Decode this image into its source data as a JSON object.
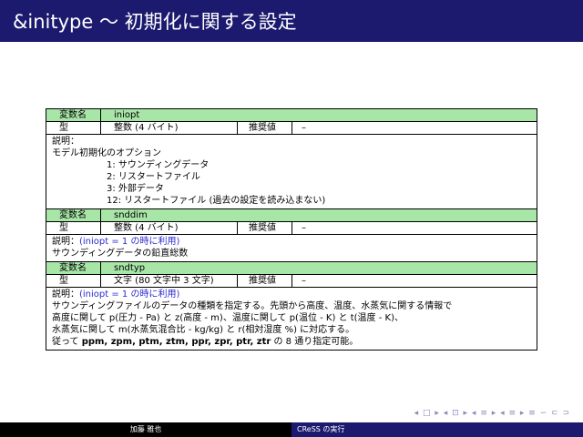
{
  "title": "&initype 〜 初期化に関する設定",
  "headers": {
    "var_label": "変数名",
    "type_label": "型",
    "rec_label": "推奨値",
    "desc_label": "説明："
  },
  "vars": [
    {
      "name": "iniopt",
      "type": "整数 (4 バイト)",
      "rec": "–",
      "desc_line": "モデル初期化のオプション",
      "options": [
        "1: サウンディングデータ",
        "2: リスタートファイル",
        "3: 外部データ",
        "12: リスタートファイル (過去の設定を読み込まない)"
      ]
    },
    {
      "name": "snddim",
      "type": "整数 (4 バイト)",
      "rec": "–",
      "cond": "(iniopt = 1 の時に利用)",
      "desc_line": "サウンディングデータの鉛直総数"
    },
    {
      "name": "sndtyp",
      "type": "文字 (80 文字中 3 文字)",
      "rec": "–",
      "cond": "(iniopt = 1 の時に利用)",
      "lines": [
        "サウンディングファイルのデータの種類を指定する。先頭から高度、温度、水蒸気に関する情報で",
        "高度に関して p(圧力 - Pa) と z(高度 - m)、温度に関して p(温位 - K) と t(温度 - K)、",
        "水蒸気に関して m(水蒸気混合比 - kg/kg) と r(相対湿度 %) に対応する。"
      ],
      "last_pre": "従って ",
      "last_bold": "ppm, zpm, ptm, ztm, ppr, zpr, ptr, ztr",
      "last_post": " の 8 通り指定可能。"
    }
  ],
  "nav_symbols": "◂ □ ▸ ◂ ⊡ ▸ ◂ ≡ ▸ ◂ ≡ ▸ ≡ ∽ ⊂ ⊃",
  "footer": {
    "author": "加藤 雅也",
    "title": "CReSS の実行"
  },
  "colors": {
    "titlebar": "#1c1a6e",
    "header_row": "#a8e6a8",
    "cond_text": "#2a2ad0"
  }
}
